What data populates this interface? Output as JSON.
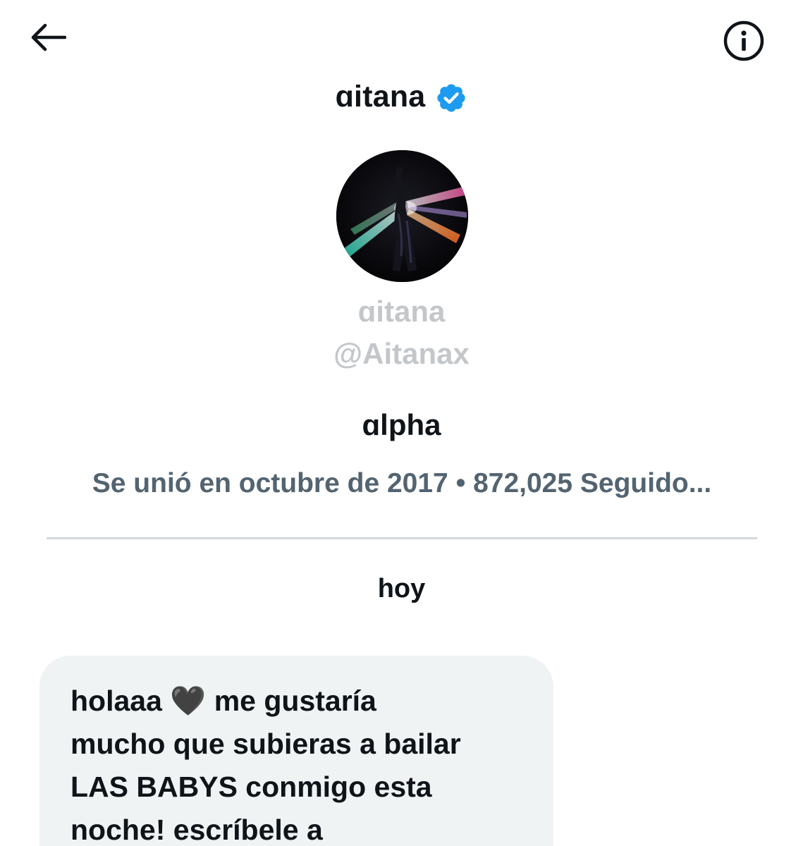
{
  "header": {
    "back_icon": "arrow-left-icon",
    "title": "ɑitana",
    "verified_icon": "verified-badge-icon",
    "info_icon": "info-icon",
    "accent_color": "#1d9bf0"
  },
  "profile": {
    "avatar_icon": "profile-photo",
    "name": "ɑitana",
    "handle": "@Aitanax",
    "bio": "ɑlpha",
    "meta": "Se unió en octubre de 2017 • 872,025 Seguido..."
  },
  "conversation": {
    "date_label": "hoy",
    "messages": [
      {
        "text": "holaaa 🖤 me gustaría\nmucho que subieras a bailar\nLAS BABYS conmigo esta\nnoche! escríbele a"
      }
    ]
  }
}
